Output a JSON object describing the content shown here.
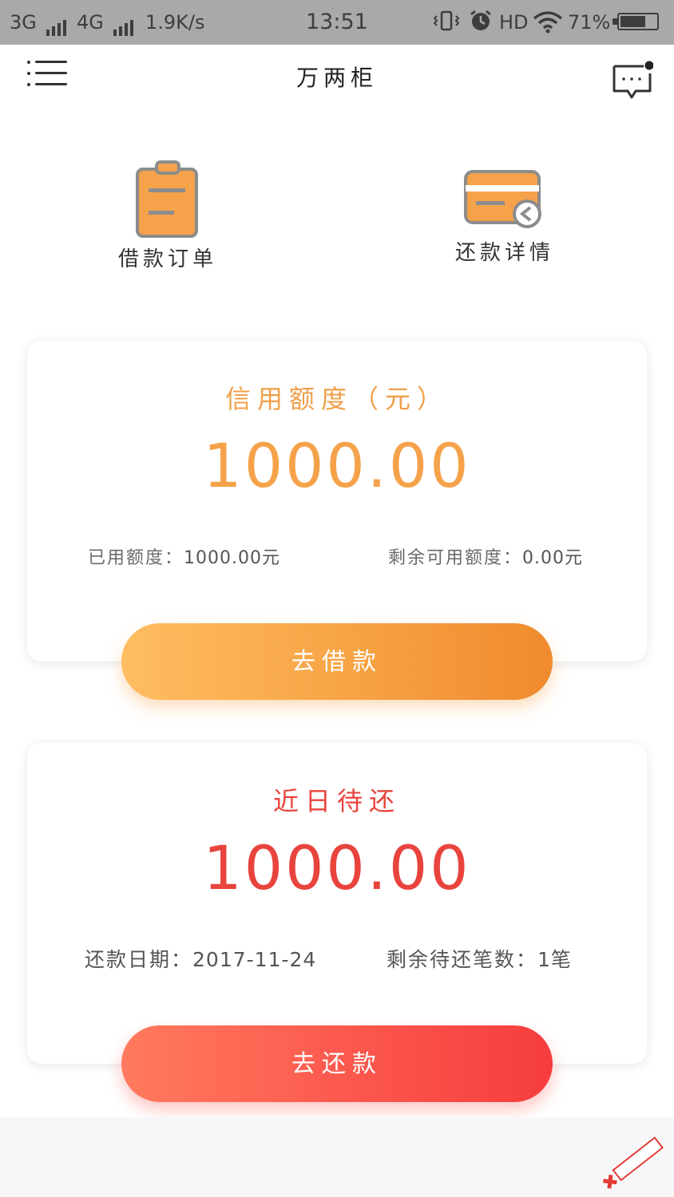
{
  "status_bar": {
    "network_left": "3G",
    "network_right": "4G",
    "speed": "1.9K/s",
    "time": "13:51",
    "hd": "HD",
    "battery_pct": "71%",
    "battery_level": 0.71
  },
  "header": {
    "title": "万两柜"
  },
  "shortcuts": {
    "orders_label": "借款订单",
    "repay_detail_label": "还款详情"
  },
  "credit_card": {
    "title": "信用额度（元）",
    "amount": "1000.00",
    "used_label": "已用额度：",
    "used_value": "1000.00元",
    "remaining_label": "剩余可用额度：",
    "remaining_value": "0.00元",
    "button_label": "去借款"
  },
  "repay_card": {
    "title": "近日待还",
    "amount": "1000.00",
    "date_label": "还款日期：",
    "date_value": "2017-11-24",
    "count_label": "剩余待还笔数：",
    "count_value": "1笔",
    "button_label": "去还款"
  },
  "colors": {
    "orange": "#f5a24a",
    "red": "#e8443d",
    "status_bar": "#a9a9a9"
  }
}
